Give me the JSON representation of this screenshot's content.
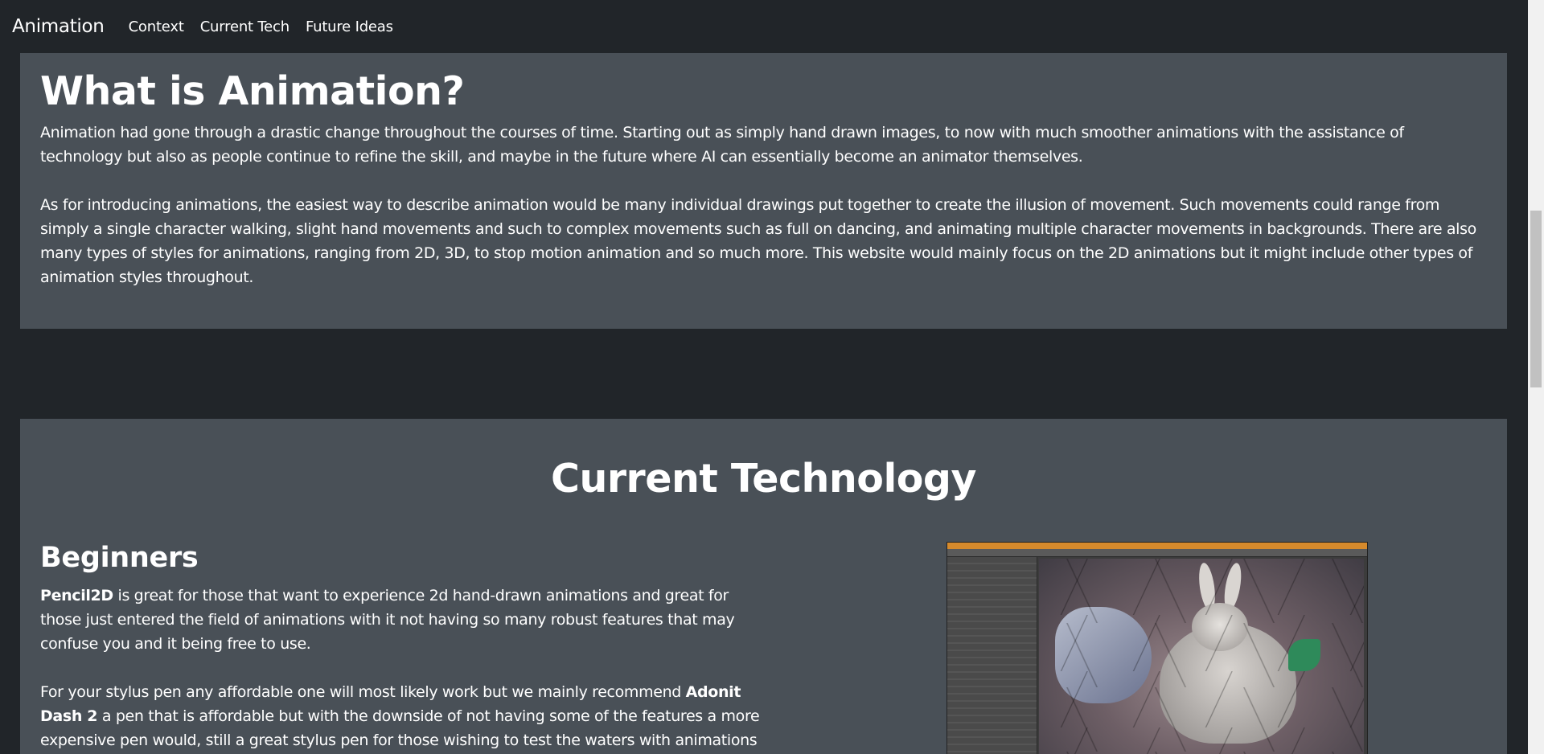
{
  "navbar": {
    "brand": "Animation",
    "links": [
      "Context",
      "Current Tech",
      "Future Ideas"
    ]
  },
  "intro": {
    "title": "What is Animation?",
    "paragraph1": "Animation had gone through a drastic change throughout the courses of time. Starting out as simply hand drawn images, to now with much smoother animations with the assistance of technology but also as people continue to refine the skill, and maybe in the future where AI can essentially become an animator themselves.",
    "paragraph2": "As for introducing animations, the easiest way to describe animation would be many individual drawings put together to create the illusion of movement. Such movements could range from simply a single character walking, slight hand movements and such to complex movements such as full on dancing, and animating multiple character movements in backgrounds. There are also many types of styles for animations, ranging from 2D, 3D, to stop motion animation and so much more. This website would mainly focus on the 2D animations but it might include other types of animation styles throughout."
  },
  "tech": {
    "title": "Current Technology",
    "beginners_heading": "Beginners",
    "p1_bold": "Pencil2D",
    "p1_rest": " is great for those that want to experience 2d hand-drawn animations and great for those just entered the field of animations with it not having so many robust features that may confuse you and it being free to use.",
    "p2_start": "For your stylus pen any affordable one will most likely work but we mainly recommend ",
    "p2_bold": "Adonit Dash 2",
    "p2_rest": " a pen that is affordable but with the downside of not having some of the features a more expensive pen would, still a great stylus pen for those wishing to test the waters with animations in"
  },
  "colors": {
    "background": "#212529",
    "card": "#495057",
    "text": "#ffffff"
  }
}
